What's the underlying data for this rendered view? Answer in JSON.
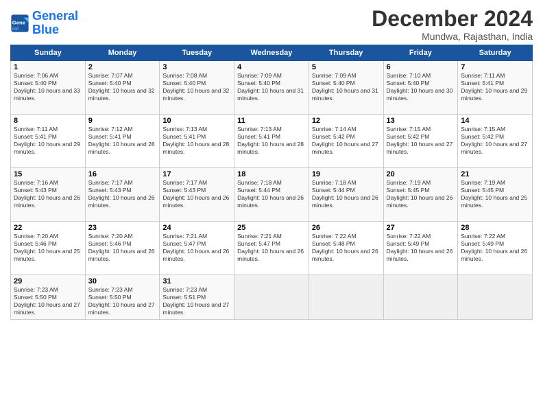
{
  "logo": {
    "line1": "General",
    "line2": "Blue"
  },
  "title": "December 2024",
  "subtitle": "Mundwa, Rajasthan, India",
  "weekdays": [
    "Sunday",
    "Monday",
    "Tuesday",
    "Wednesday",
    "Thursday",
    "Friday",
    "Saturday"
  ],
  "weeks": [
    [
      {
        "day": "1",
        "sunrise": "7:06 AM",
        "sunset": "5:40 PM",
        "daylight": "10 hours and 33 minutes."
      },
      {
        "day": "2",
        "sunrise": "7:07 AM",
        "sunset": "5:40 PM",
        "daylight": "10 hours and 32 minutes."
      },
      {
        "day": "3",
        "sunrise": "7:08 AM",
        "sunset": "5:40 PM",
        "daylight": "10 hours and 32 minutes."
      },
      {
        "day": "4",
        "sunrise": "7:09 AM",
        "sunset": "5:40 PM",
        "daylight": "10 hours and 31 minutes."
      },
      {
        "day": "5",
        "sunrise": "7:09 AM",
        "sunset": "5:40 PM",
        "daylight": "10 hours and 31 minutes."
      },
      {
        "day": "6",
        "sunrise": "7:10 AM",
        "sunset": "5:40 PM",
        "daylight": "10 hours and 30 minutes."
      },
      {
        "day": "7",
        "sunrise": "7:11 AM",
        "sunset": "5:41 PM",
        "daylight": "10 hours and 29 minutes."
      }
    ],
    [
      {
        "day": "8",
        "sunrise": "7:11 AM",
        "sunset": "5:41 PM",
        "daylight": "10 hours and 29 minutes."
      },
      {
        "day": "9",
        "sunrise": "7:12 AM",
        "sunset": "5:41 PM",
        "daylight": "10 hours and 28 minutes."
      },
      {
        "day": "10",
        "sunrise": "7:13 AM",
        "sunset": "5:41 PM",
        "daylight": "10 hours and 28 minutes."
      },
      {
        "day": "11",
        "sunrise": "7:13 AM",
        "sunset": "5:41 PM",
        "daylight": "10 hours and 28 minutes."
      },
      {
        "day": "12",
        "sunrise": "7:14 AM",
        "sunset": "5:42 PM",
        "daylight": "10 hours and 27 minutes."
      },
      {
        "day": "13",
        "sunrise": "7:15 AM",
        "sunset": "5:42 PM",
        "daylight": "10 hours and 27 minutes."
      },
      {
        "day": "14",
        "sunrise": "7:15 AM",
        "sunset": "5:42 PM",
        "daylight": "10 hours and 27 minutes."
      }
    ],
    [
      {
        "day": "15",
        "sunrise": "7:16 AM",
        "sunset": "5:43 PM",
        "daylight": "10 hours and 26 minutes."
      },
      {
        "day": "16",
        "sunrise": "7:17 AM",
        "sunset": "5:43 PM",
        "daylight": "10 hours and 26 minutes."
      },
      {
        "day": "17",
        "sunrise": "7:17 AM",
        "sunset": "5:43 PM",
        "daylight": "10 hours and 26 minutes."
      },
      {
        "day": "18",
        "sunrise": "7:18 AM",
        "sunset": "5:44 PM",
        "daylight": "10 hours and 26 minutes."
      },
      {
        "day": "19",
        "sunrise": "7:18 AM",
        "sunset": "5:44 PM",
        "daylight": "10 hours and 26 minutes."
      },
      {
        "day": "20",
        "sunrise": "7:19 AM",
        "sunset": "5:45 PM",
        "daylight": "10 hours and 26 minutes."
      },
      {
        "day": "21",
        "sunrise": "7:19 AM",
        "sunset": "5:45 PM",
        "daylight": "10 hours and 25 minutes."
      }
    ],
    [
      {
        "day": "22",
        "sunrise": "7:20 AM",
        "sunset": "5:46 PM",
        "daylight": "10 hours and 25 minutes."
      },
      {
        "day": "23",
        "sunrise": "7:20 AM",
        "sunset": "5:46 PM",
        "daylight": "10 hours and 26 minutes."
      },
      {
        "day": "24",
        "sunrise": "7:21 AM",
        "sunset": "5:47 PM",
        "daylight": "10 hours and 26 minutes."
      },
      {
        "day": "25",
        "sunrise": "7:21 AM",
        "sunset": "5:47 PM",
        "daylight": "10 hours and 26 minutes."
      },
      {
        "day": "26",
        "sunrise": "7:22 AM",
        "sunset": "5:48 PM",
        "daylight": "10 hours and 26 minutes."
      },
      {
        "day": "27",
        "sunrise": "7:22 AM",
        "sunset": "5:49 PM",
        "daylight": "10 hours and 26 minutes."
      },
      {
        "day": "28",
        "sunrise": "7:22 AM",
        "sunset": "5:49 PM",
        "daylight": "10 hours and 26 minutes."
      }
    ],
    [
      {
        "day": "29",
        "sunrise": "7:23 AM",
        "sunset": "5:50 PM",
        "daylight": "10 hours and 27 minutes."
      },
      {
        "day": "30",
        "sunrise": "7:23 AM",
        "sunset": "5:50 PM",
        "daylight": "10 hours and 27 minutes."
      },
      {
        "day": "31",
        "sunrise": "7:23 AM",
        "sunset": "5:51 PM",
        "daylight": "10 hours and 27 minutes."
      },
      null,
      null,
      null,
      null
    ]
  ]
}
